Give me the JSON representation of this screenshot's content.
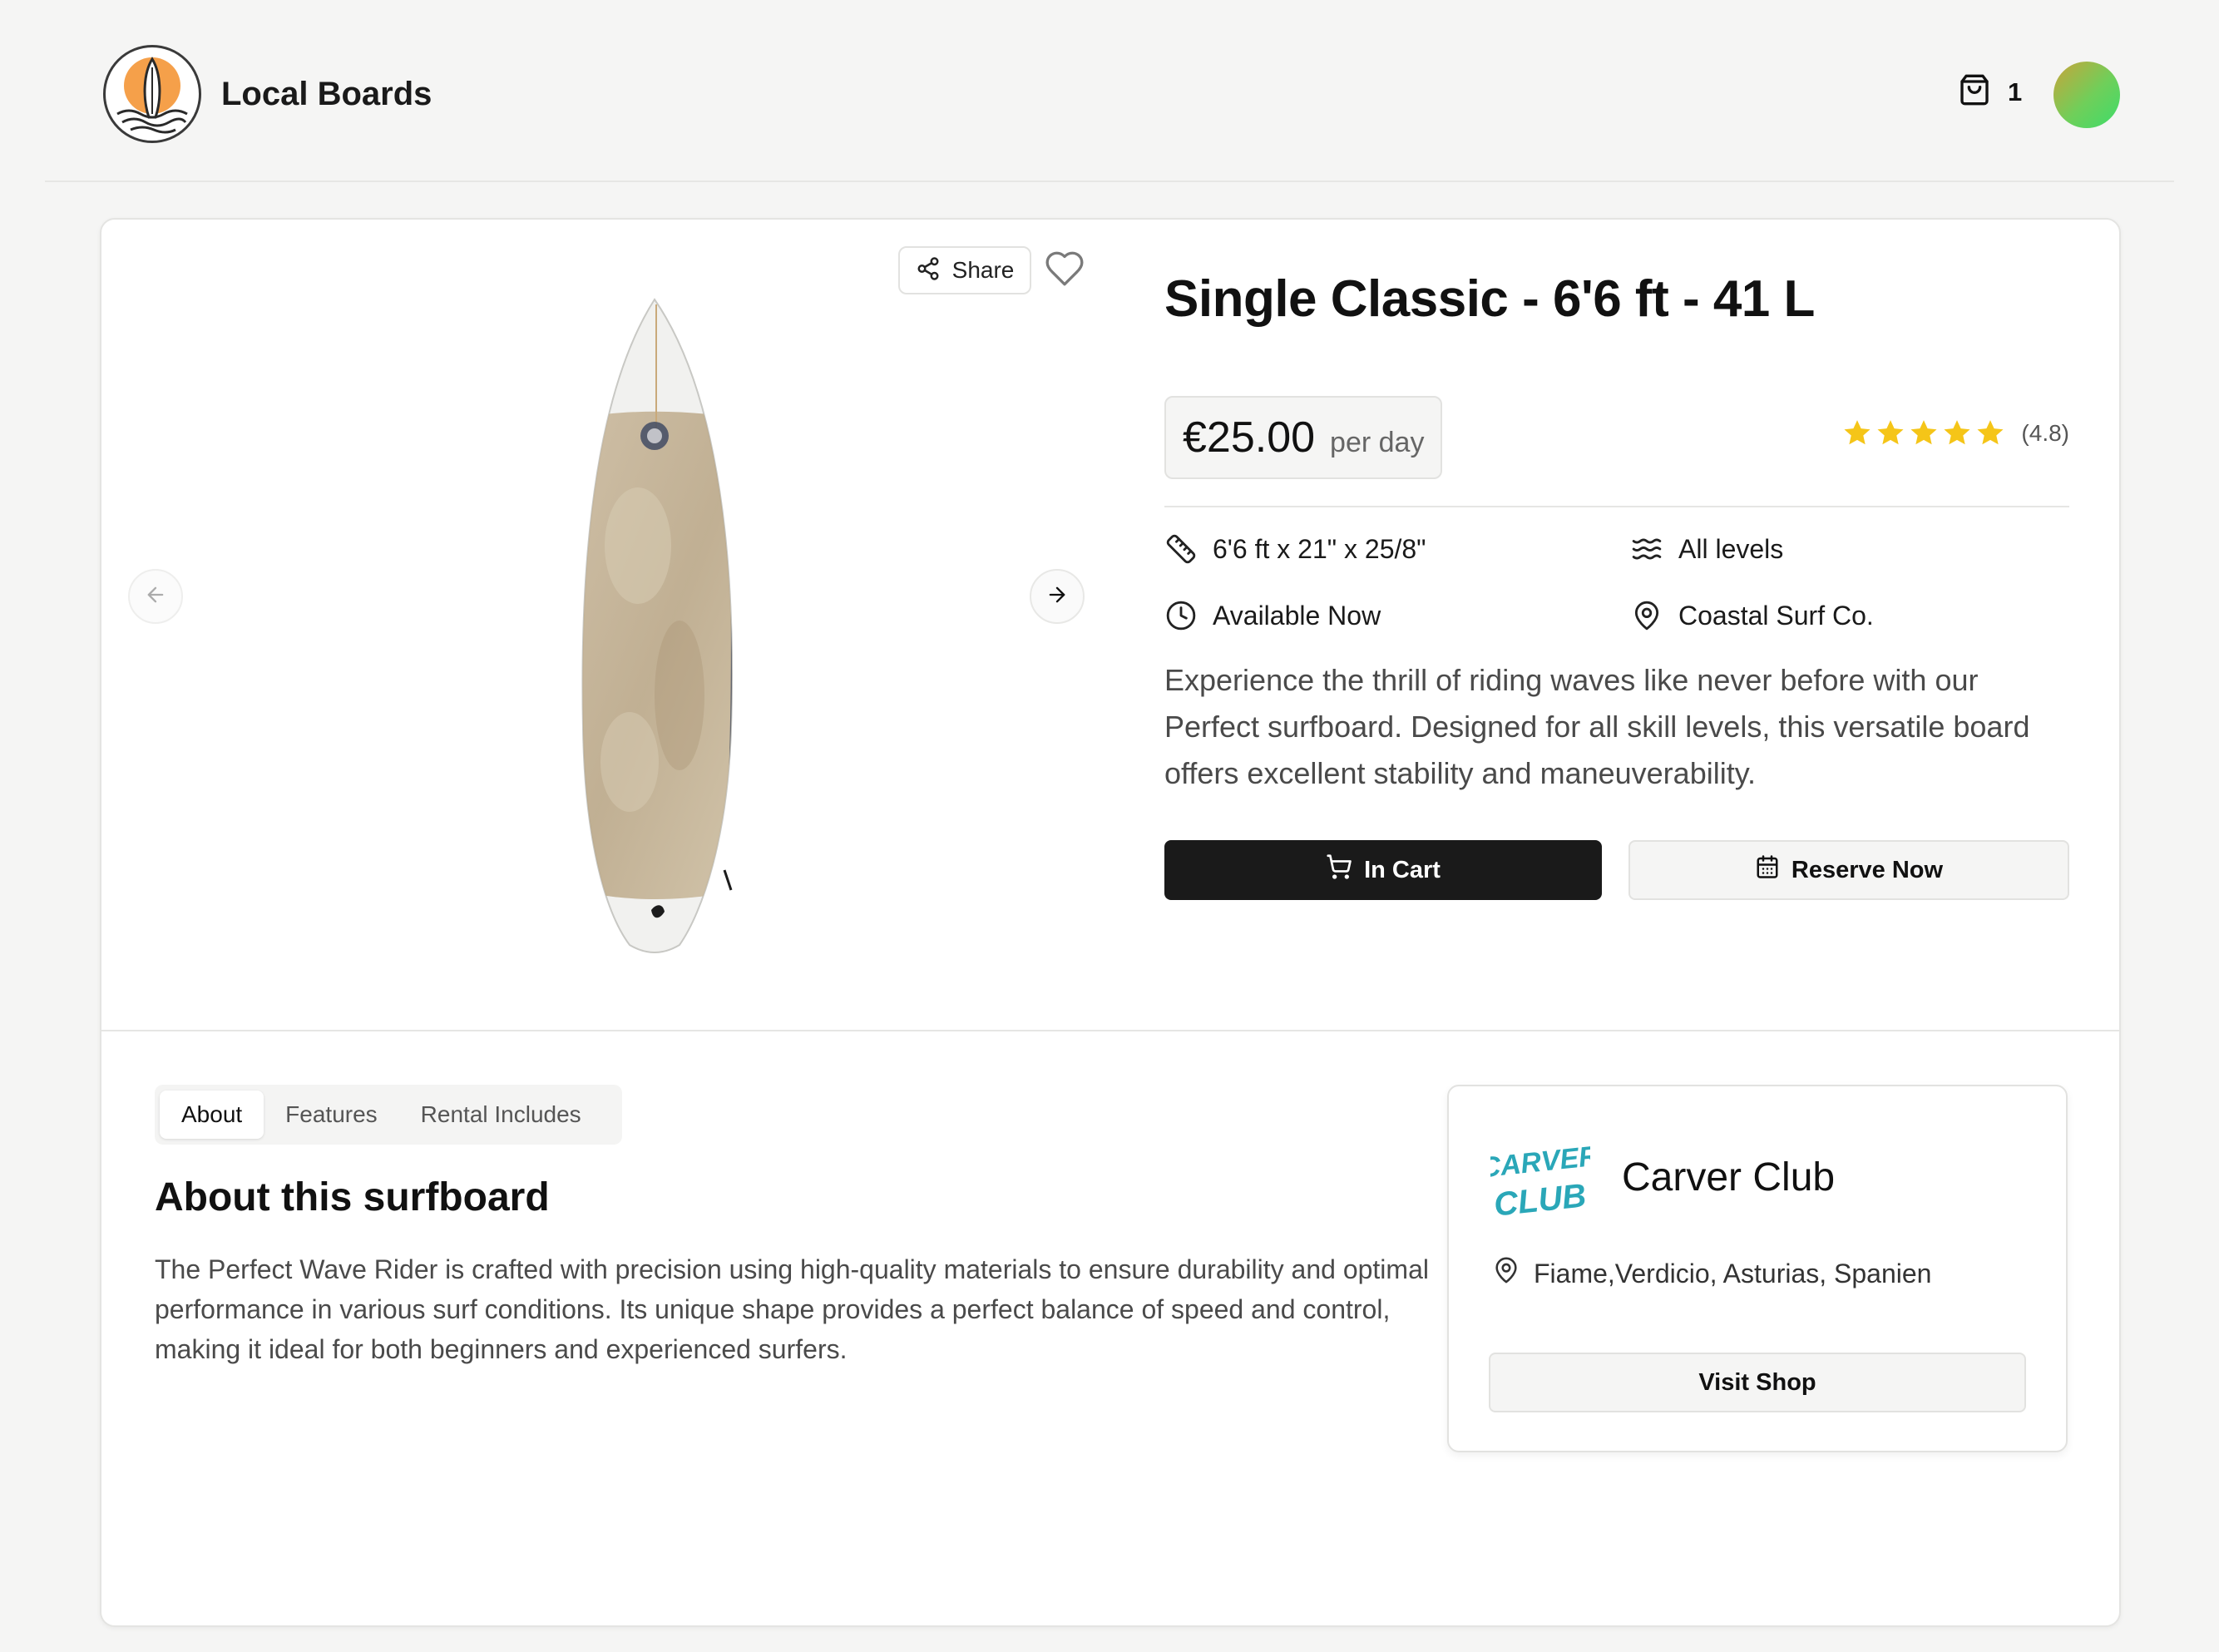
{
  "header": {
    "brand_name": "Local Boards",
    "cart_count": "1"
  },
  "gallery": {
    "share_label": "Share"
  },
  "product": {
    "title": "Single Classic - 6'6 ft - 41 L",
    "price": "€25.00",
    "price_unit": "per day",
    "rating": 4.8,
    "rating_label": "(4.8)",
    "specs": {
      "size": "6'6 ft x 21\" x 25/8\"",
      "level": "All levels",
      "availability": "Available Now",
      "location": "Coastal Surf Co."
    },
    "description": "Experience the thrill of riding waves like never before with our Perfect surfboard. Designed for all skill levels, this versatile board offers excellent stability and maneuverability.",
    "cart_button_label": "In Cart",
    "reserve_button_label": "Reserve Now"
  },
  "details": {
    "tabs": [
      {
        "label": "About",
        "active": true
      },
      {
        "label": "Features",
        "active": false
      },
      {
        "label": "Rental Includes",
        "active": false
      }
    ],
    "about_title": "About this surfboard",
    "about_body": "The Perfect Wave Rider is crafted with precision using high-quality materials to ensure durability and optimal performance in various surf conditions. Its unique shape provides a perfect balance of speed and control, making it ideal for both beginners and experienced surfers."
  },
  "shop": {
    "logo_text": "CARVER CLUB",
    "name": "Carver Club",
    "address": "Fiame,Verdicio, Asturias, Spanien",
    "visit_button_label": "Visit Shop"
  },
  "colors": {
    "primary_button": "#1a1a1a",
    "star": "#f5c518",
    "logo_sun": "#f5a04a",
    "shop_logo": "#2aa7b8"
  }
}
